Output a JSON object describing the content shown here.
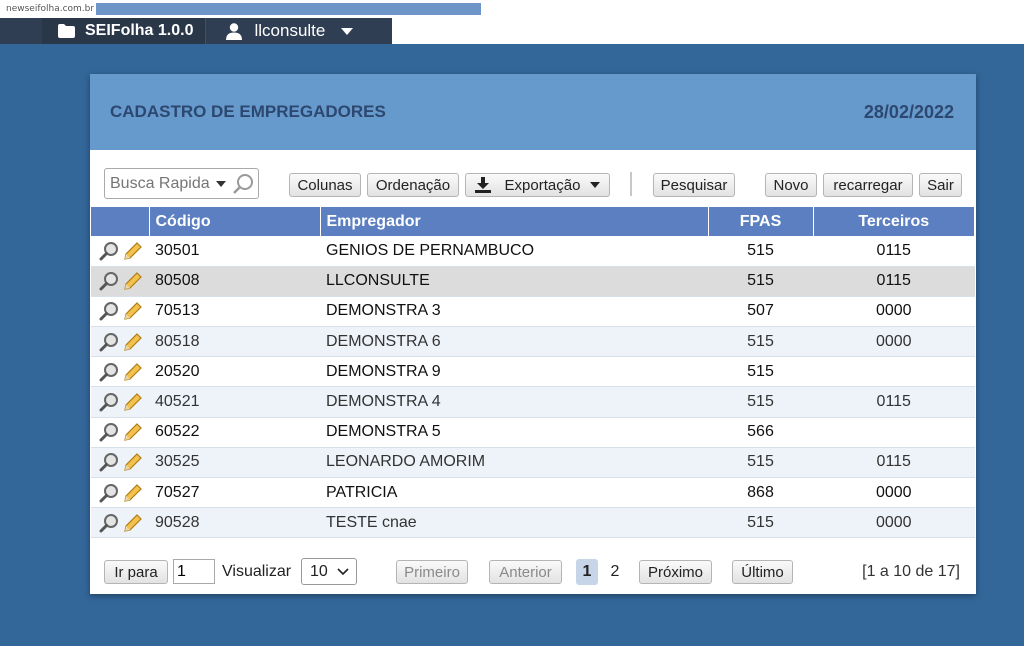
{
  "browser": {
    "url": "newseifolha.com.br"
  },
  "topnav": {
    "brand": "SEIFolha 1.0.0",
    "user": "llconsulte"
  },
  "panel": {
    "title": "CADASTRO DE EMPREGADORES",
    "date": "28/02/2022"
  },
  "toolbar": {
    "search_placeholder": "Busca Rapida",
    "colunas": "Colunas",
    "ordenacao": "Ordenação",
    "exportacao": "Exportação",
    "pesquisar": "Pesquisar",
    "novo": "Novo",
    "recarregar": "recarregar",
    "sair": "Sair"
  },
  "table": {
    "headers": {
      "codigo": "Código",
      "empregador": "Empregador",
      "fpas": "FPAS",
      "terceiros": "Terceiros"
    },
    "rows": [
      {
        "codigo": "30501",
        "empregador": "GENIOS DE PERNAMBUCO",
        "fpas": "515",
        "terceiros": "0115"
      },
      {
        "codigo": "80508",
        "empregador": "LLCONSULTE",
        "fpas": "515",
        "terceiros": "0115"
      },
      {
        "codigo": "70513",
        "empregador": "DEMONSTRA 3",
        "fpas": "507",
        "terceiros": "0000"
      },
      {
        "codigo": "80518",
        "empregador": "DEMONSTRA 6",
        "fpas": "515",
        "terceiros": "0000"
      },
      {
        "codigo": "20520",
        "empregador": "DEMONSTRA 9",
        "fpas": "515",
        "terceiros": ""
      },
      {
        "codigo": "40521",
        "empregador": "DEMONSTRA 4",
        "fpas": "515",
        "terceiros": "0115"
      },
      {
        "codigo": "60522",
        "empregador": "DEMONSTRA 5",
        "fpas": "566",
        "terceiros": ""
      },
      {
        "codigo": "30525",
        "empregador": "LEONARDO AMORIM",
        "fpas": "515",
        "terceiros": "0115"
      },
      {
        "codigo": "70527",
        "empregador": "PATRICIA",
        "fpas": "868",
        "terceiros": "0000"
      },
      {
        "codigo": "90528",
        "empregador": "TESTE cnae",
        "fpas": "515",
        "terceiros": "0000"
      }
    ]
  },
  "pager": {
    "ir_para": "Ir para",
    "page_input": "1",
    "visualizar": "Visualizar",
    "page_size": "10",
    "primeiro": "Primeiro",
    "anterior": "Anterior",
    "page1": "1",
    "page2": "2",
    "proximo": "Próximo",
    "ultimo": "Último",
    "info": "[1 a 10 de 17]"
  },
  "colors": {
    "background": "#336699",
    "header": "#6699cc",
    "grid_header": "#5b7fc0",
    "nav": "#2f3e52"
  }
}
